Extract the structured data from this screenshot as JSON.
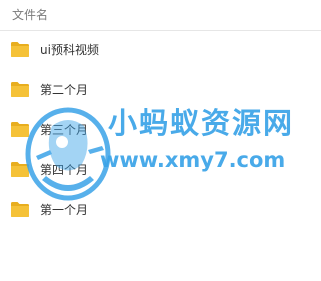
{
  "header": {
    "column_label": "文件名"
  },
  "files": [
    {
      "name": "ui预科视频",
      "icon": "folder-icon"
    },
    {
      "name": "第二个月",
      "icon": "folder-icon"
    },
    {
      "name": "第三个月",
      "icon": "folder-icon"
    },
    {
      "name": "第四个月",
      "icon": "folder-icon"
    },
    {
      "name": "第一个月",
      "icon": "folder-icon"
    }
  ],
  "watermark": {
    "title": "小蚂蚁资源网",
    "url": "www.xmy7.com"
  },
  "colors": {
    "folder": "#f5c238",
    "folder_tab": "#e8ae1f",
    "watermark": "#3aa3e8",
    "text": "#333333",
    "header_text": "#7a7a7a"
  }
}
